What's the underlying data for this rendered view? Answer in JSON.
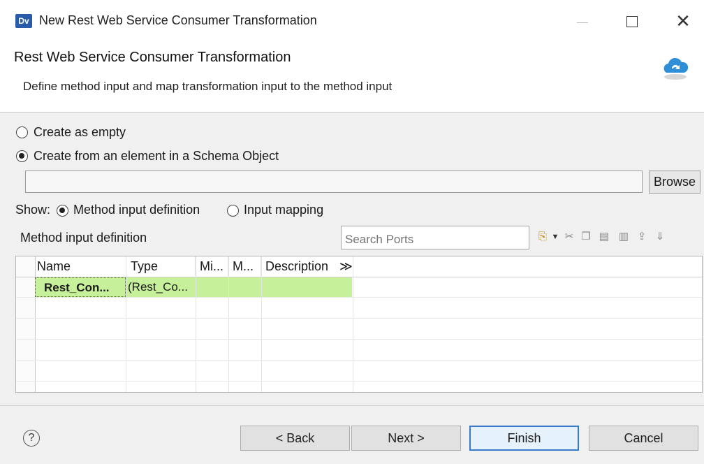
{
  "window": {
    "app_icon_text": "Dv",
    "title": "New Rest Web Service Consumer Transformation",
    "close_glyph": "✕"
  },
  "header": {
    "title": "Rest Web Service Consumer Transformation",
    "description": "Define method input and map transformation input to the method input",
    "icon": "cloud-sync-icon"
  },
  "create": {
    "empty_label": "Create as empty",
    "from_schema_label": "Create from an element in a Schema Object",
    "selected": "from_schema",
    "schema_path": ""
  },
  "browse_label": "Browse",
  "show": {
    "label": "Show:",
    "definition_label": "Method input definition",
    "mapping_label": "Input mapping",
    "selected": "definition"
  },
  "section_label": "Method input definition",
  "search": {
    "placeholder": "Search Ports"
  },
  "table": {
    "columns": [
      "Name",
      "Type",
      "Mi...",
      "M...",
      "Description"
    ],
    "more_columns_glyph": "≫",
    "rows": [
      {
        "name": "Rest_Con...",
        "type": "(Rest_Co...",
        "min": "",
        "max": "",
        "description": ""
      }
    ]
  },
  "footer": {
    "help_glyph": "?",
    "back_label": "< Back",
    "next_label": "Next >",
    "finish_label": "Finish",
    "cancel_label": "Cancel"
  },
  "colors": {
    "selected_row": "#c7f09a",
    "accent": "#3a78c8"
  }
}
